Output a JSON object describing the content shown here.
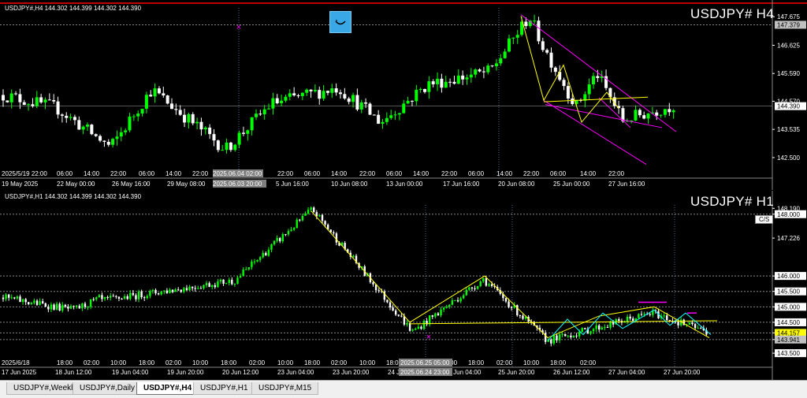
{
  "h4": {
    "info": "USDJPY#,H4 144.302 144.399 144.302 144.390",
    "title": "USDJPY# H4",
    "price_labels": [
      "147.675",
      "146.625",
      "145.590",
      "144.570",
      "143.535",
      "142.500"
    ],
    "price_values": [
      147.675,
      146.625,
      145.59,
      144.57,
      143.535,
      142.5
    ],
    "current_price": "144.390",
    "hline_price": "147.379",
    "time_row1": [
      "2025/5/19 22:00",
      "06:00",
      "14:00",
      "22:00",
      "06:00",
      "14:00",
      "22:00",
      "2025.06.04 02:00",
      "22:00",
      "06:00",
      "14:00",
      "22:00",
      "06:00",
      "14:00",
      "22:00",
      "06:00",
      "14:00",
      "22:00",
      "06:00",
      "14:00",
      "22:00"
    ],
    "time_row2": [
      "19 May 2025",
      "22 May 00:00",
      "26 May 16:00",
      "29 May 08:00",
      "2025.06.03 20:00",
      "5 Jun 16:00",
      "10 Jun 08:00",
      "13 Jun 00:00",
      "17 Jun 16:00",
      "20 Jun 08:00",
      "25 Jun 00:00",
      "27 Jun 16:00"
    ]
  },
  "h1": {
    "info": "USDJPY#,H1 144.302 144.399 144.302 144.390",
    "title": "USDJPY# H1",
    "cs_label": "C/S",
    "price_labels": [
      "148.190",
      "148.000",
      "147.226",
      "146.000",
      "145.500",
      "145.000",
      "144.500",
      "144.157",
      "143.941",
      "143.500"
    ],
    "price_values": [
      148.19,
      148.0,
      147.226,
      146.0,
      145.5,
      145.0,
      144.5,
      144.157,
      143.941,
      143.5
    ],
    "time_row": [
      "17 Jun 2025",
      "18 Jun 12:00",
      "19 Jun 04:00",
      "19 Jun 20:00",
      "20 Jun 12:00",
      "23 Jun 04:00",
      "23 Jun 20:00",
      "24 Jun 12:00",
      "25 Jun 04:00",
      "25 Jun 20:00",
      "26 Jun 12:00",
      "27 Jun 04:00",
      "27 Jun 20:00"
    ],
    "time_row_top": [
      "2025/6/18",
      "18:00",
      "02:00",
      "10:00",
      "18:00",
      "02:00",
      "10:00",
      "18:00",
      "02:00",
      "10:00",
      "18:00",
      "02:00",
      "10:00",
      "18:00",
      "02:00",
      "10:00",
      "18:00",
      "02:00",
      "10:00",
      "18:00",
      "02:00"
    ],
    "time_highlight_top": "2025.06.25 05:00",
    "time_highlight_bottom": "2025.06.24 23:00"
  },
  "tabs": [
    "USDJPY#,Weekly",
    "USDJPY#,Daily",
    "USDJPY#,H4",
    "USDJPY#,H1",
    "USDJPY#,M15"
  ],
  "active_tab": "USDJPY#,H4",
  "colors": {
    "bull": "#00ff00",
    "bear": "#ffffff",
    "yellow": "#ffff00",
    "magenta": "#ff00ff",
    "cyan": "#00ffff",
    "grid": "#4a4a4a"
  }
}
